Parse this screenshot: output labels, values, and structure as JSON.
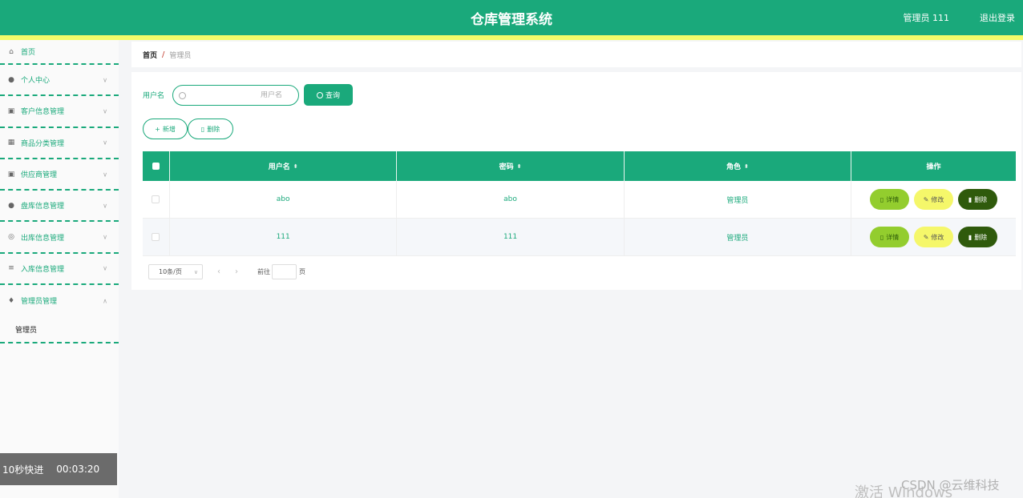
{
  "header": {
    "title": "仓库管理系统",
    "user": "管理员 111",
    "logout": "退出登录"
  },
  "sidebar": {
    "items": [
      {
        "label": "首页",
        "icon": "home-icon"
      },
      {
        "label": "个人中心",
        "icon": "user-icon"
      },
      {
        "label": "客户信息管理",
        "icon": "clipboard-icon"
      },
      {
        "label": "商品分类管理",
        "icon": "grid-icon"
      },
      {
        "label": "供应商管理",
        "icon": "clipboard-icon"
      },
      {
        "label": "盘库信息管理",
        "icon": "user-icon"
      },
      {
        "label": "出库信息管理",
        "icon": "box-icon"
      },
      {
        "label": "入库信息管理",
        "icon": "list-icon"
      },
      {
        "label": "管理员管理",
        "icon": "pin-icon"
      }
    ],
    "submenu": {
      "label": "管理员"
    }
  },
  "breadcrumb": {
    "home": "首页",
    "separator": "/",
    "current": "管理员"
  },
  "search": {
    "label": "用户名",
    "placeholder": "用户名",
    "button": "查询"
  },
  "actions": {
    "add": "新增",
    "delete": "删除"
  },
  "table": {
    "columns": [
      "用户名",
      "密码",
      "角色",
      "操作"
    ],
    "rows": [
      {
        "username": "abo",
        "password": "abo",
        "role": "管理员"
      },
      {
        "username": "111",
        "password": "111",
        "role": "管理员"
      }
    ],
    "row_actions": {
      "detail": "详情",
      "edit": "修改",
      "delete": "删除"
    }
  },
  "pagination": {
    "page_size": "10条/页",
    "goto_label": "前往",
    "unit": "页"
  },
  "overlay": {
    "video_label": "10秒快进",
    "video_time": "00:03:20",
    "watermark": "激活 Windows",
    "csdn": "CSDN @云维科技"
  },
  "colors": {
    "primary": "#1aa97b",
    "strip": "#f3fb6a",
    "detail": "#93cd2e",
    "edit": "#f5f76a",
    "delete": "#2f5a0c"
  }
}
